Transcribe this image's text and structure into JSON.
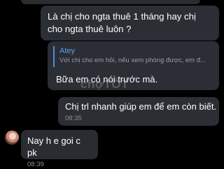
{
  "messages": [
    {
      "direction": "out",
      "text": "Là chị cho ngta thuê 1 tháng hay chị cho ngta thuê luôn ?"
    },
    {
      "direction": "out",
      "reply": {
        "author": "Atey",
        "text": "Với chị cho em hỏi, nếu xem phòng được, em đ..."
      },
      "text": "Bữa em có nói trước mà."
    },
    {
      "direction": "out",
      "text": "Chị trl nhanh giúp em để em còn biết.",
      "time": "08:35"
    },
    {
      "direction": "in",
      "text": "Nay h e goi c pk",
      "time": "08:39"
    }
  ],
  "watermark": "chợTỐT",
  "colors": {
    "background": "#000000",
    "bubble": "#2a2c31",
    "quote_bar": "#4a8fe2",
    "quote_name": "#5a9ef2"
  }
}
